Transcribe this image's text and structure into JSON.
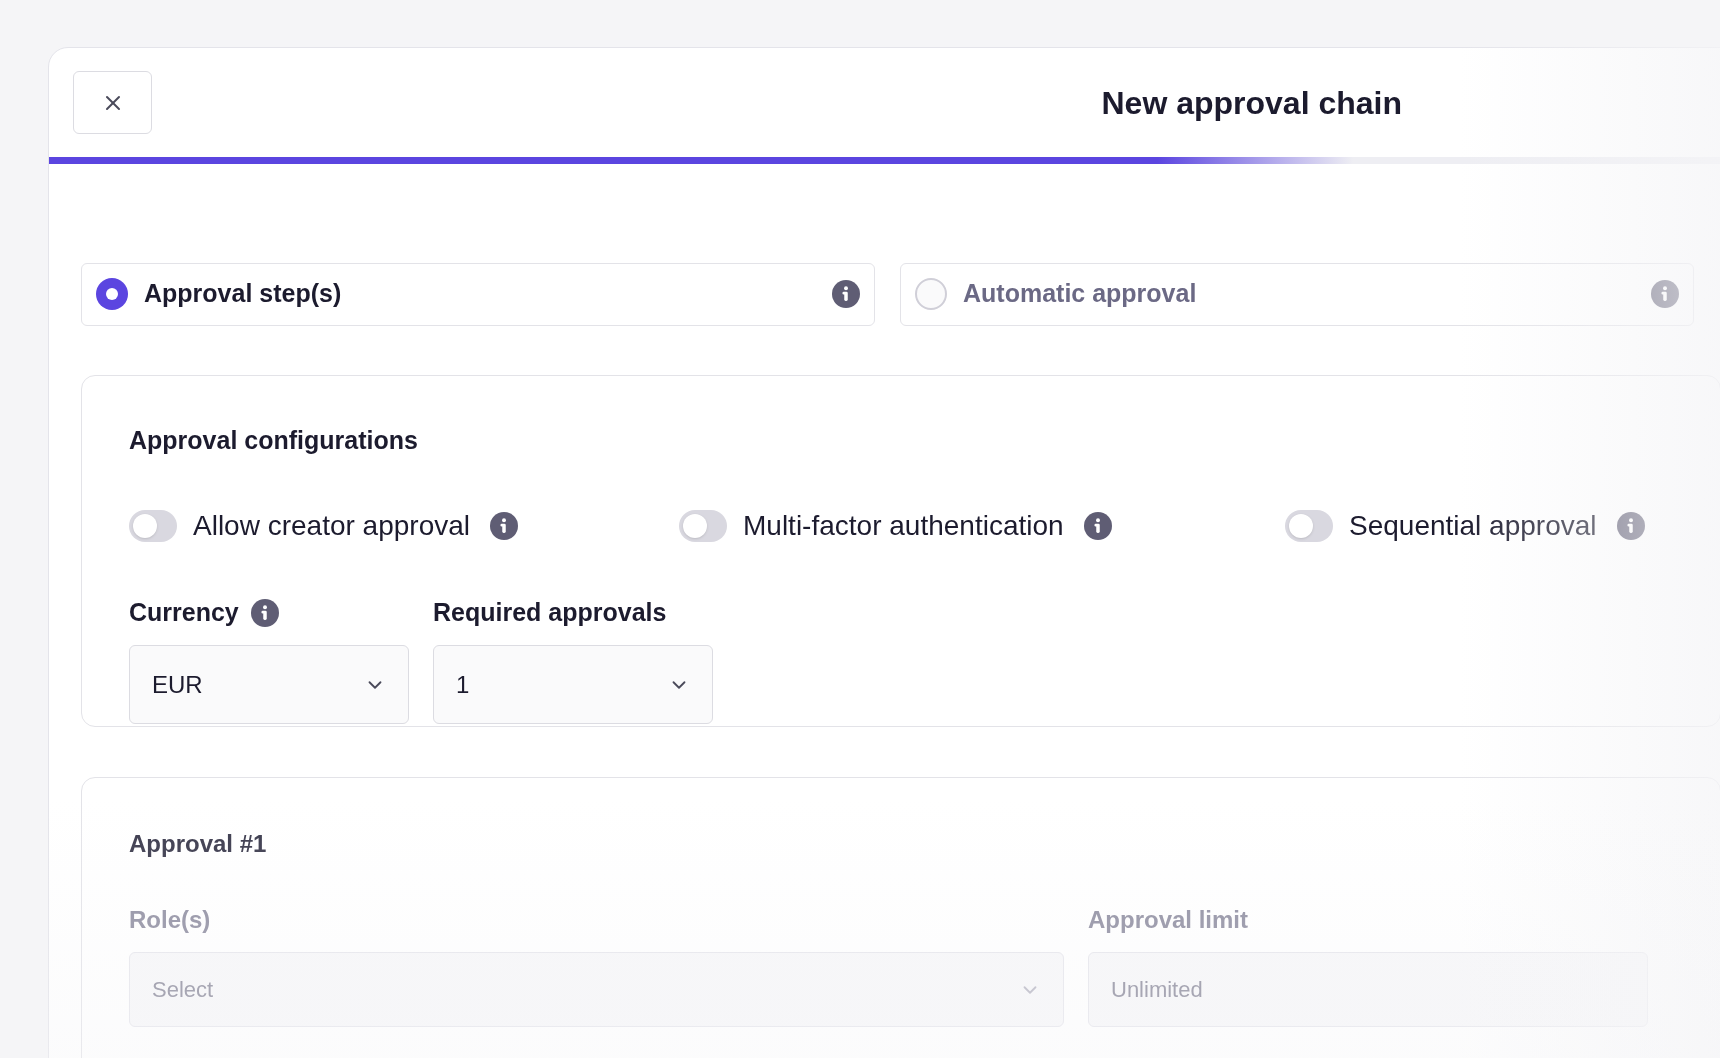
{
  "dialog": {
    "title": "New approval chain",
    "progress": {
      "level": 0.78
    }
  },
  "approval_types": [
    {
      "label": "Approval step(s)",
      "selected": true
    },
    {
      "label": "Automatic approval",
      "selected": false
    }
  ],
  "configurations": {
    "title": "Approval configurations",
    "toggles": [
      {
        "label": "Allow creator approval",
        "on": false
      },
      {
        "label": "Multi-factor authentication",
        "on": false
      },
      {
        "label": "Sequential approval",
        "on": false
      }
    ],
    "fields": [
      {
        "label": "Currency",
        "info": true,
        "value": "EUR"
      },
      {
        "label": "Required approvals",
        "info": false,
        "value": "1"
      }
    ]
  },
  "approval": {
    "title": "Approval #1",
    "fields": [
      {
        "label": "Role(s)",
        "placeholder": "Select",
        "kind": "select"
      },
      {
        "label": "Approval limit",
        "placeholder": "Unlimited",
        "kind": "input"
      }
    ]
  }
}
